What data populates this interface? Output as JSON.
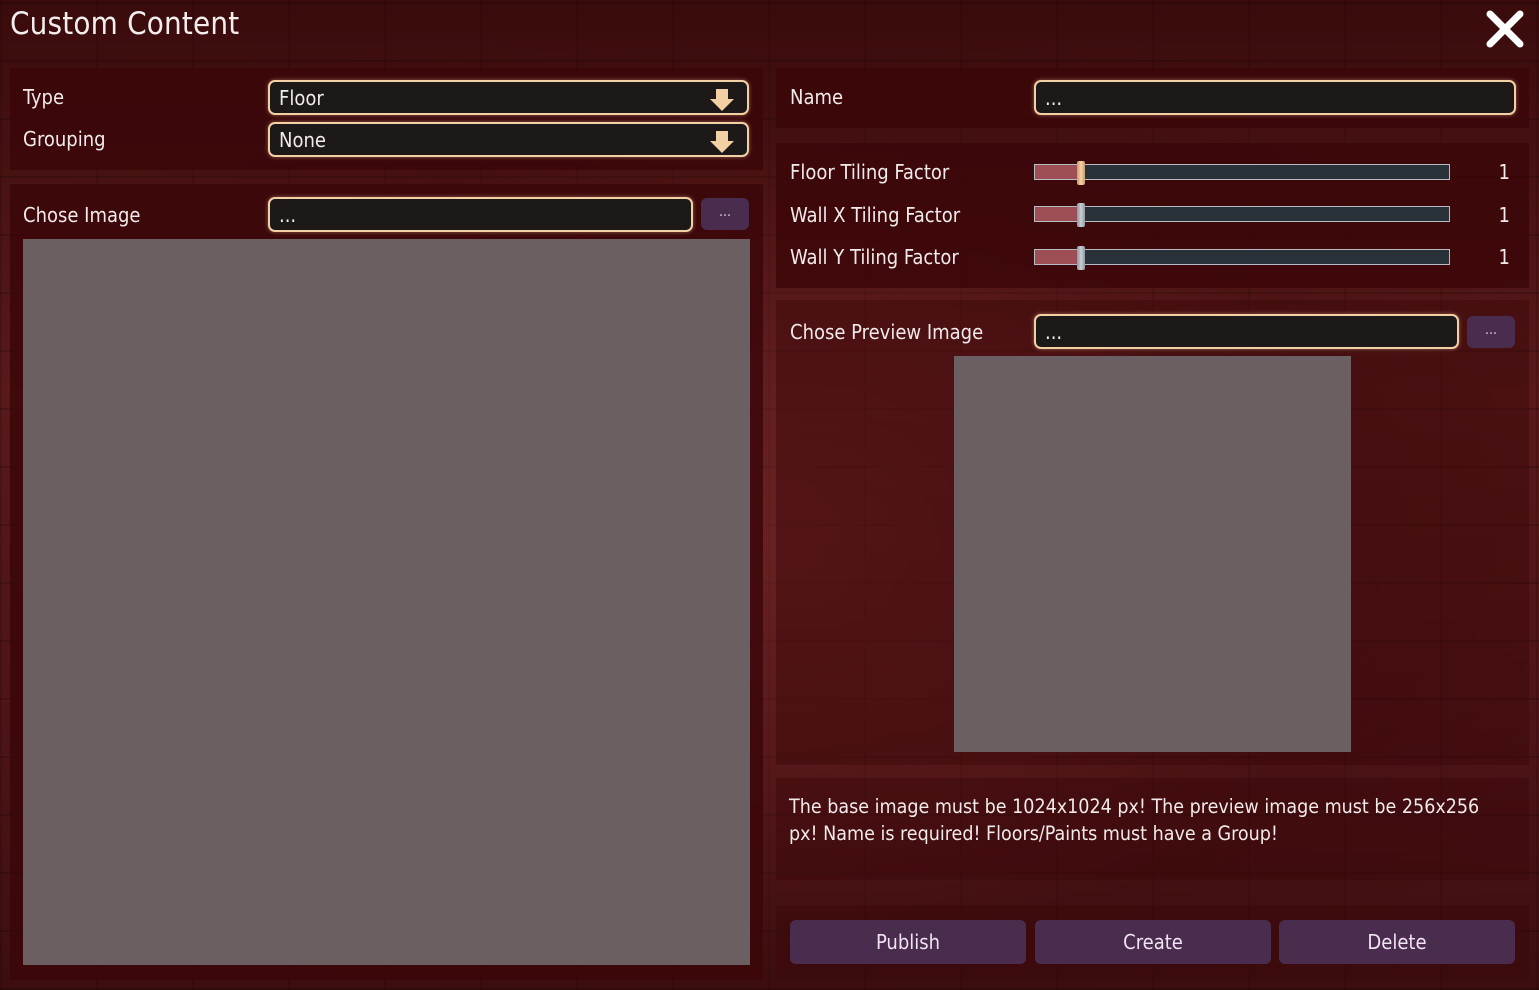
{
  "window": {
    "title": "Custom Content"
  },
  "left": {
    "type_label": "Type",
    "type_value": "Floor",
    "grouping_label": "Grouping",
    "grouping_value": "None",
    "chose_image_label": "Chose Image",
    "chose_image_value": "...",
    "browse_label": "..."
  },
  "right": {
    "name_label": "Name",
    "name_value": "...",
    "sliders": [
      {
        "label": "Floor Tiling Factor",
        "value": "1",
        "fraction": 0.11
      },
      {
        "label": "Wall X Tiling Factor",
        "value": "1",
        "fraction": 0.11
      },
      {
        "label": "Wall Y Tiling Factor",
        "value": "1",
        "fraction": 0.11
      }
    ],
    "preview_label": "Chose Preview Image",
    "preview_value": "...",
    "browse_label": "...",
    "note": "The base image must be 1024x1024 px! The preview image must be 256x256 px! Name is required! Floors/Paints must have a Group!",
    "buttons": {
      "publish": "Publish",
      "create": "Create",
      "delete": "Delete"
    }
  },
  "colors": {
    "panel": "#3a0608",
    "field_border": "#f3cfa4",
    "button": "#4a2d4e",
    "slider_fill": "#9d4f55",
    "image_placeholder": "#6b5f61"
  },
  "icons": {
    "close": "close-icon",
    "dropdown": "arrow-down-icon"
  }
}
